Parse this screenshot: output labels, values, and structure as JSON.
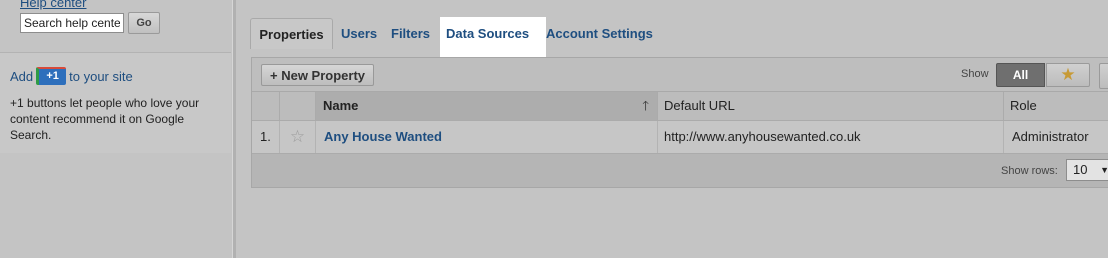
{
  "sidebar": {
    "help_link": "Help center",
    "search": {
      "value": "Search help cente",
      "placeholder": "Search help center"
    },
    "go_label": "Go",
    "plus_one": {
      "prefix": "Add",
      "badge": "+1",
      "suffix": "to your site",
      "description": "+1 buttons let people who love your content recommend it on Google Search."
    }
  },
  "tabs": [
    {
      "label": "Properties",
      "active": true
    },
    {
      "label": "Users",
      "active": false
    },
    {
      "label": "Filters",
      "active": false
    },
    {
      "label": "Data Sources",
      "active": false,
      "highlighted": true
    },
    {
      "label": "Account Settings",
      "active": false
    }
  ],
  "toolbar": {
    "new_property_label": "+ New Property",
    "show_label": "Show",
    "show_all_label": "All",
    "show_starred_icon": "star-icon"
  },
  "table": {
    "columns": [
      "Name",
      "Default URL",
      "Role"
    ],
    "sort_icon": "arrow-up-icon",
    "rows": [
      {
        "index": "1.",
        "starred": false,
        "name": "Any House Wanted",
        "url": "http://www.anyhousewanted.co.uk",
        "role": "Administrator"
      }
    ],
    "show_rows_label": "Show rows:",
    "show_rows_value": "10"
  },
  "colors": {
    "link": "#1e4e80",
    "background": "#c4c4c4",
    "highlight": "#ffffff",
    "active_filter": "#6f6f6f",
    "star": "#c79a35"
  }
}
